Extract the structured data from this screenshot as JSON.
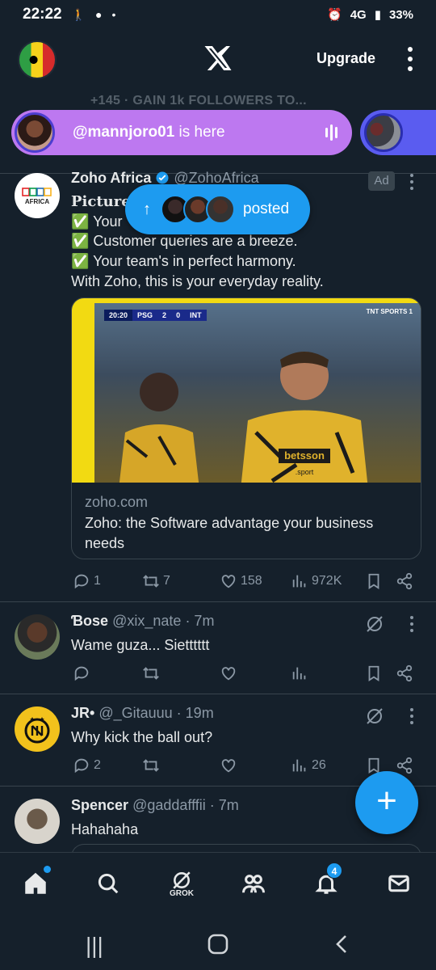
{
  "status_bar": {
    "time": "22:22",
    "network": "4G",
    "battery": "33%"
  },
  "header": {
    "logo": "x-logo-icon",
    "upgrade_label": "Upgrade"
  },
  "spaces_banner": {
    "gain_text": "+145 · GAIN 1k FOLLOWERS TO...",
    "host_handle": "@mannjoro01",
    "host_suffix": " is here"
  },
  "posted_pill": {
    "label": "posted"
  },
  "posts": [
    {
      "name": "Zoho Africa",
      "handle": "@ZohoAfrica",
      "ad_label": "Ad",
      "verified": true,
      "avatar_text": "AFRICA",
      "lines": [
        "Picture t",
        "✅ Your",
        "✅ Customer queries are a breeze.",
        "✅ Your team's in perfect harmony.",
        "With Zoho, this is your everyday reality."
      ],
      "card": {
        "scorebug": [
          "20:20",
          "PSG",
          "2",
          "0",
          "INT"
        ],
        "broadcaster": "TNT SPORTS 1",
        "shirt_text": "betsson",
        "shirt_subtext": ".sport",
        "domain": "zoho.com",
        "title": "Zoho: the Software advantage your business needs"
      },
      "stats": {
        "replies": "1",
        "reposts": "7",
        "likes": "158",
        "views": "972K"
      }
    },
    {
      "name": "Ɓose",
      "handle": "@xix_nate",
      "time": "· 7m",
      "text": "Wame guza... Sietttttt",
      "stats": {
        "replies": "",
        "reposts": "",
        "likes": "",
        "views": ""
      }
    },
    {
      "name": "JR•",
      "handle": "@_Gitauuu",
      "time": "· 19m",
      "text": "Why kick the ball out?",
      "stats": {
        "replies": "2",
        "reposts": "",
        "likes": "",
        "views": "26"
      }
    },
    {
      "name": "Spencer",
      "handle": "@gaddafffii",
      "time": "· 7m",
      "text": "Hahahaha"
    }
  ],
  "bottom_nav": {
    "grok_label": "GROK",
    "notifications_count": "4"
  },
  "colors": {
    "background": "#15202b",
    "accent": "#1d9bf0",
    "spaces_purple": "#bd78f0",
    "muted": "#8b98a5"
  }
}
